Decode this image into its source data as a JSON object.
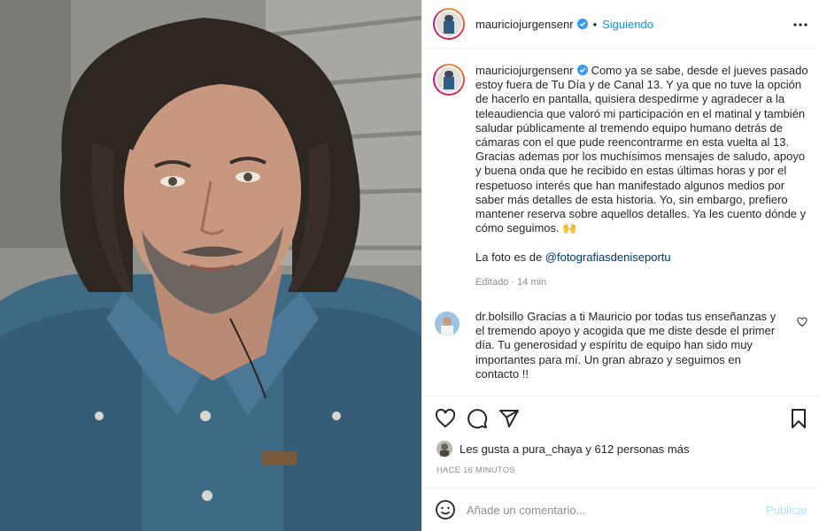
{
  "post": {
    "username": "mauriciojurgensenr",
    "follow_status": "Siguiendo",
    "separator": "•",
    "image_alt": "Retrato de hombre con cabello largo y camisa de mezclilla"
  },
  "caption": {
    "username": "mauriciojurgensenr",
    "text": "Como ya se sabe, desde el jueves pasado estoy fuera de Tu Día y de Canal 13. Y ya que no tuve la opción de hacerlo en pantalla, quisiera despedirme y agradecer a la teleaudiencia que valoró mi participación en el matinal y también saludar públicamente al tremendo equipo humano detrás de cámaras con el que pude reencontrarme en esta vuelta al 13. Gracias ademas por los muchísimos mensajes de saludo, apoyo y buena onda que he recibido en estas últimas horas y por el respetuoso interés que han manifestado algunos medios por saber más detalles de esta historia. Yo, sin embargo, prefiero mantener reserva sobre aquellos detalles. Ya les cuento dónde y cómo seguimos. 🙌",
    "photo_credit_prefix": "La foto es de ",
    "photo_credit_mention": "@fotografiasdeniseportu",
    "edited_label": "Editado",
    "edited_time": "14 min"
  },
  "comment": {
    "username": "dr.bolsillo",
    "text": "Gracias a ti Mauricio por todas tus enseñanzas y el tremendo apoyo y acogida que me diste desde el primer día. Tu generosidad y espíritu de equipo han sido muy importantes para mí. Un gran abrazo y seguimos en contacto !!"
  },
  "likes": {
    "text": "Les gusta a pura_chaya y 612 personas más"
  },
  "timestamp": "HACE 16 MINUTOS",
  "add_comment": {
    "placeholder": "Añade un comentario...",
    "post_label": "Publicar"
  },
  "icons": {
    "like": "heart-icon",
    "comment": "comment-icon",
    "share": "paper-plane-icon",
    "save": "bookmark-icon",
    "more": "more-icon",
    "emoji": "emoji-icon",
    "verified": "verified-badge-icon"
  },
  "colors": {
    "accent": "#0095f6",
    "mention": "#00376b",
    "verified": "#3897f0",
    "muted": "#8e8e8e",
    "post_disabled": "#b2dffc"
  }
}
